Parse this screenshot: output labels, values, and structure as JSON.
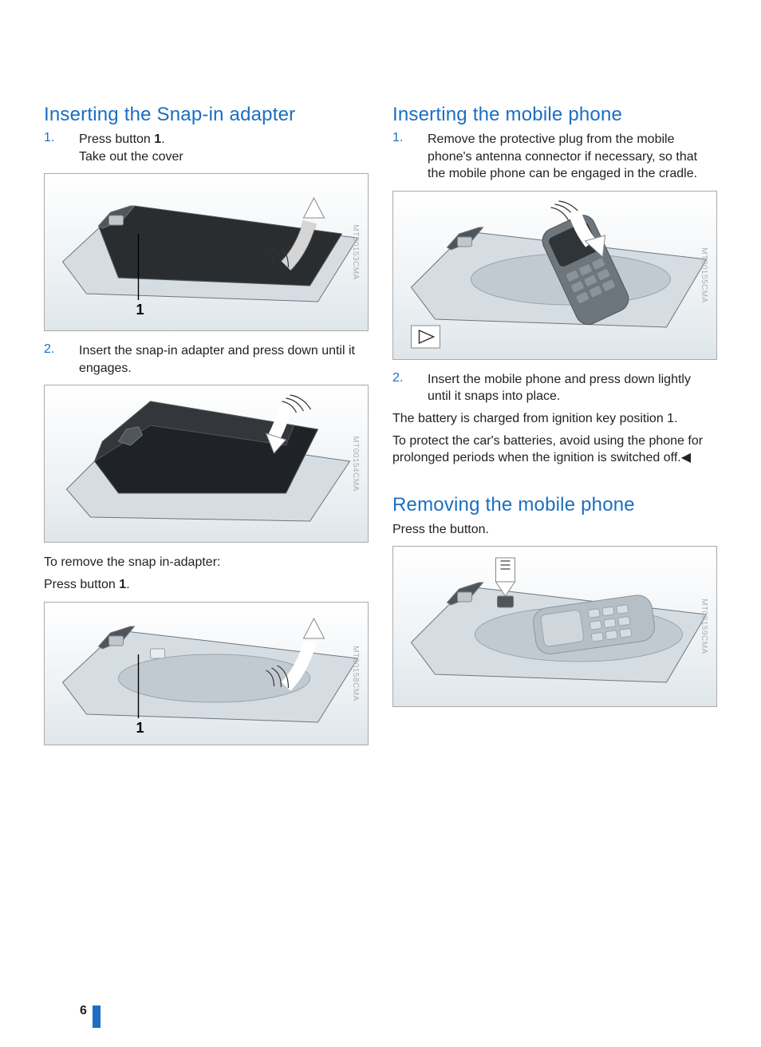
{
  "left": {
    "heading1": "Inserting the Snap-in adapter",
    "step1_num": "1.",
    "step1a": "Press button ",
    "step1_bold": "1",
    "step1b": ".",
    "step1c": "Take out the cover",
    "step2_num": "2.",
    "step2": "Insert the snap-in adapter and press down until it engages.",
    "remove1": "To remove the snap in-adapter:",
    "remove2a": "Press button ",
    "remove2_bold": "1",
    "remove2b": "."
  },
  "right": {
    "heading1": "Inserting the mobile phone",
    "step1_num": "1.",
    "step1": "Remove the protective plug from the mobile phone's antenna connector if necessary, so that the mobile phone can be engaged in the cradle.",
    "step2_num": "2.",
    "step2": "Insert the mobile phone and press down lightly until it snaps into place.",
    "note1": "The battery is charged from ignition key position 1.",
    "note2": "To protect the car's batteries, avoid using the phone for prolonged periods when the ignition is switched off.◀",
    "heading2": "Removing the mobile phone",
    "press": "Press the button."
  },
  "captions": {
    "figA": "MT00153CMA",
    "figB": "MT00154CMA",
    "figC": "MT00158CMA",
    "figD": "MT00155CMA",
    "figE": "MT00159CMA"
  },
  "page_number": "6"
}
